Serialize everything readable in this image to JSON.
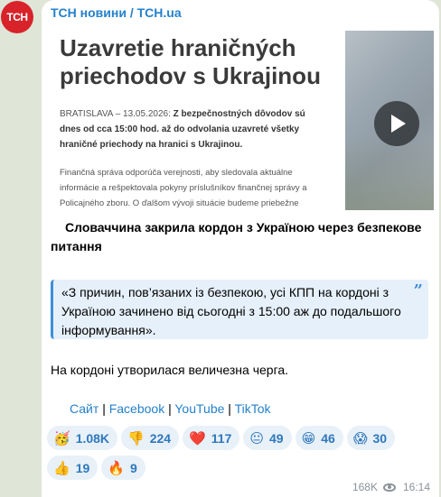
{
  "channel": {
    "avatar_text": "ТСН",
    "name": "ТСН новини / TCH.ua"
  },
  "media": {
    "doc_title": "Uzavretie hraničných priechodov s Ukrajinou",
    "doc_dateline": "BRATISLAVA – 13.05.2026: ",
    "doc_lead_bold": "Z bezpečnostných dôvodov sú dnes od cca 15:00 hod. až do odvolania uzavreté všetky hraničné priechody na hranici s Ukrajinou.",
    "doc_body": "Finančná správa odporúča verejnosti, aby sledovala aktuálne informácie a rešpektovala pokyny príslušníkov finančnej správy a Policajného zboru. O ďalšom vývoji situácie budeme priebežne informovať."
  },
  "post": {
    "headline": "Словаччина закрила кордон з Україною через безпекове питання",
    "quote": "«З причин, пов’язаних із безпекою, усі КПП на кордоні з Україною зачинено від сьогодні з 15:00 аж до подальшого інформування».",
    "body": "На кордоні утворилася величезна черга.",
    "links": [
      "Сайт",
      "Facebook",
      "YouTube",
      "TikTok"
    ]
  },
  "reactions": [
    {
      "emoji": "🥳",
      "count": "1.08K"
    },
    {
      "emoji": "👎",
      "count": "224"
    },
    {
      "emoji": "❤️",
      "count": "117"
    },
    {
      "emoji": "😐",
      "count": "49"
    },
    {
      "emoji": "😁",
      "count": "46"
    },
    {
      "emoji": "😱",
      "count": "30"
    },
    {
      "emoji": "👍",
      "count": "19"
    },
    {
      "emoji": "🔥",
      "count": "9"
    }
  ],
  "footer": {
    "views": "168K",
    "time": "16:14"
  },
  "colors": {
    "accent": "#2481cc",
    "avatar": "#d8232a",
    "quote_bg": "#e6f0fa"
  }
}
